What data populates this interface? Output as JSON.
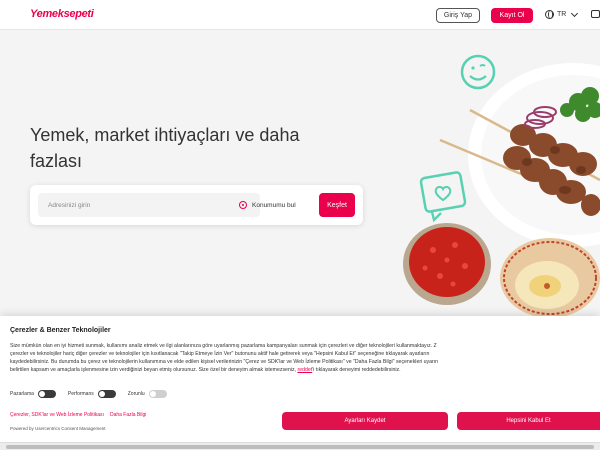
{
  "header": {
    "logo": "Yemeksepeti",
    "login_label": "Giriş Yap",
    "signup_label": "Kayıt Ol",
    "language": "TR"
  },
  "hero": {
    "title": "Yemek, market ihtiyaçları ve daha fazlası",
    "address_placeholder": "Adresinizi girin",
    "locate_label": "Konumumu bul",
    "discover_label": "Keşfet"
  },
  "cookie": {
    "title": "Çerezler & Benzer Teknolojiler",
    "lines": [
      "Size mümkün olan en iyi hizmeti sunmak, kullanımı analiz etmek ve ilgi alanlarınıza göre uyarlanmış pazarlama kampanyaları sunmak için çerezleri ve diğer teknolojileri kullanmaktayız. Z",
      "çerezler ve teknolojiler hariç diğer çerezler ve teknolojiler için kısıtlanacak \"Takip Etmeye İzin Ver\" butonunu aktif hale getirerek veya \"Hepsini Kabul Et\" seçeneğine tıklayarak ayarların",
      "kaydedebilirsiniz. Bu durumda bu çerez ve teknolojilerin kullanımına ve elde edilen kişisel verilerinizin \"Çerez ve SDK'lar ve Web İzleme Politikası\" ve \"Daha Fazla Bilgi\" seçenekleri uyarın",
      "belirtilen kapsam ve amaçlarla işlenmesine izin verdiğinizi beyan etmiş olursunuz. Size özel bir deneyim almak istemezseniz,"
    ],
    "reddet_link": "reddet",
    "line4_tail": "'i tıklayarak deneyimi reddedebilirsiniz.",
    "toggles": [
      "Pazarlama",
      "Performans",
      "Zorunlu"
    ],
    "policy_link": "Çerezler, SDK'lar ve Web İzleme Politikası",
    "more_info_link": "Daha Fazla Bilgi",
    "powered_by": "Powered by Usercentrics Consent Management",
    "settings_label": "Ayarları Kaydet",
    "accept_all_label": "Hepsini Kabul Et"
  },
  "colors": {
    "brand": "#ea004b",
    "brand_button": "#e0124e",
    "background": "#f4f4f4"
  },
  "icons": [
    "globe-icon",
    "chevron-down-icon",
    "cart-icon",
    "location-target-icon",
    "smiley-icon",
    "heart-chat-icon"
  ]
}
